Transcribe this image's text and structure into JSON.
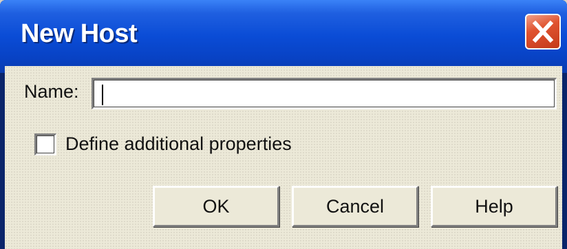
{
  "window": {
    "title": "New Host",
    "close_icon": "close-icon",
    "title_color": "#ffffff",
    "titlebar_color": "#0a4cd6",
    "close_color": "#e0532f"
  },
  "form": {
    "name_label": "Name:",
    "name_value": "",
    "checkbox_label": "Define additional properties",
    "checkbox_checked": false
  },
  "buttons": {
    "ok_label": "OK",
    "cancel_label": "Cancel",
    "help_label": "Help"
  }
}
